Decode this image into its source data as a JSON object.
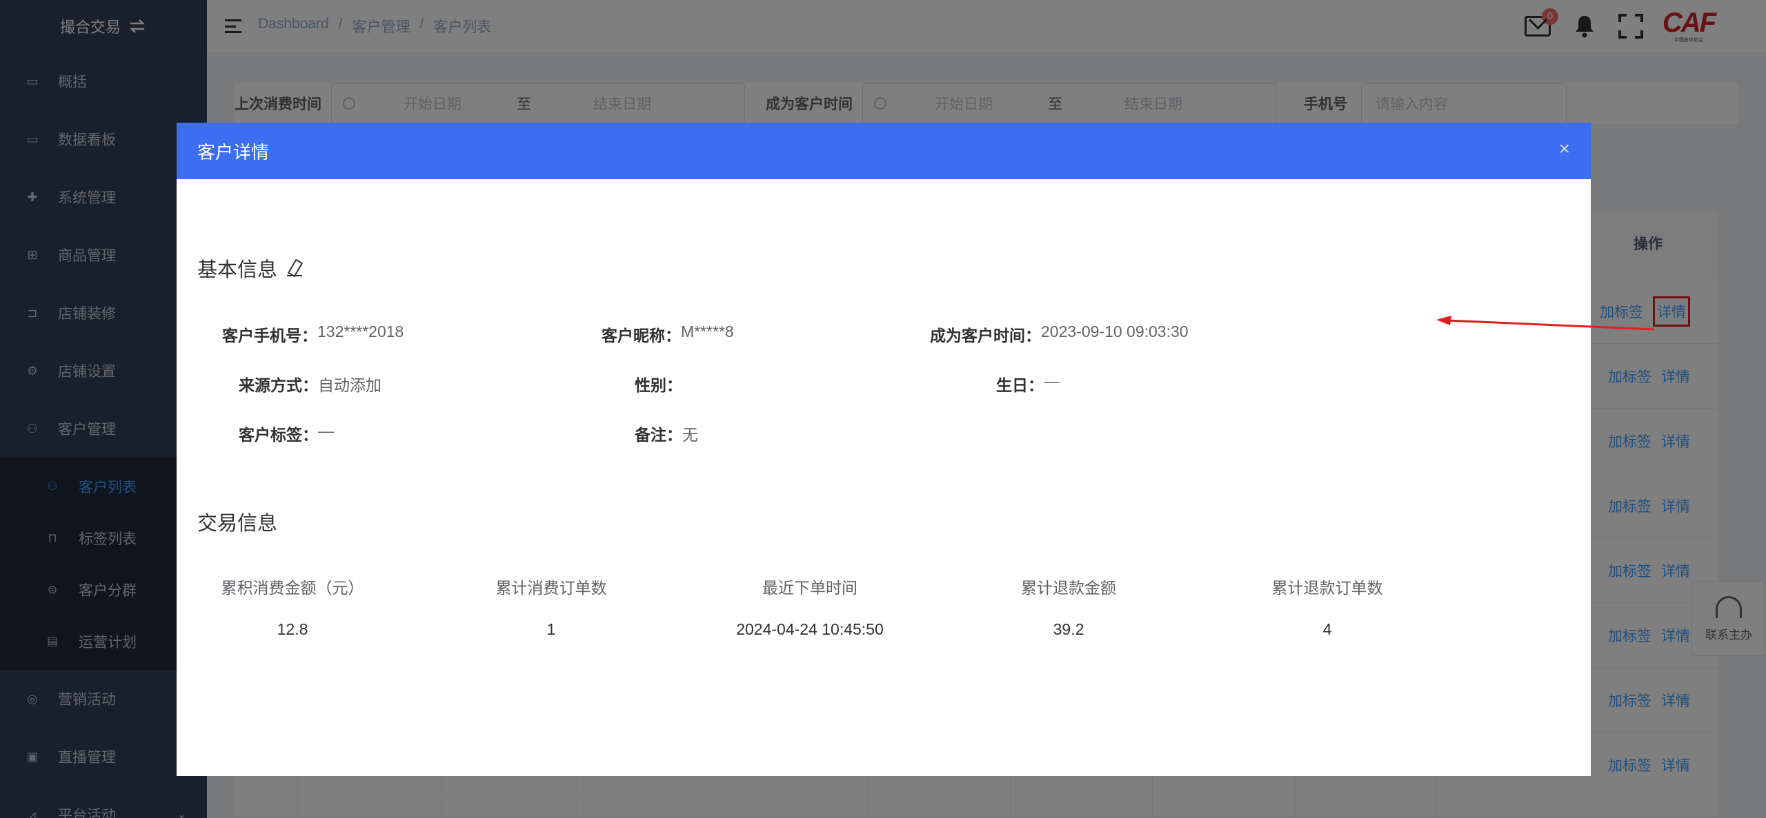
{
  "sidebar": {
    "brand": "撮合交易",
    "items": [
      {
        "label": "概括",
        "icon": "monitor-icon"
      },
      {
        "label": "数据看板",
        "icon": "monitor-icon"
      },
      {
        "label": "系统管理",
        "icon": "gear-icon"
      },
      {
        "label": "商品管理",
        "icon": "box-icon"
      },
      {
        "label": "店铺装修",
        "icon": "cart-icon"
      },
      {
        "label": "店铺设置",
        "icon": "settings-icon"
      },
      {
        "label": "客户管理",
        "icon": "user-icon"
      }
    ],
    "sub_items": [
      {
        "label": "客户列表",
        "icon": "user-icon",
        "active": true
      },
      {
        "label": "标签列表",
        "icon": "bookmark-icon"
      },
      {
        "label": "客户分群",
        "icon": "group-icon"
      },
      {
        "label": "运营计划",
        "icon": "card-icon"
      }
    ],
    "items_after": [
      {
        "label": "营销活动",
        "icon": "compass-icon"
      },
      {
        "label": "直播管理",
        "icon": "video-icon"
      },
      {
        "label": "平台活动",
        "icon": "chart-icon"
      }
    ]
  },
  "navbar": {
    "breadcrumb": [
      "Dashboard",
      "/",
      "客户管理",
      "/",
      "客户列表"
    ],
    "mail_badge": "0",
    "logo_text": "CAF",
    "logo_sub": "中国肢体协会"
  },
  "filter": {
    "last_consume_label": "上次消费时间",
    "become_customer_label": "成为客户时间",
    "start_placeholder": "开始日期",
    "to": "至",
    "end_placeholder": "结束日期",
    "phone_label": "手机号",
    "phone_placeholder": "请输入内容"
  },
  "table": {
    "op_header": "操作",
    "add_tag": "加标签",
    "detail": "详情",
    "row_count": 8
  },
  "contact": {
    "label": "联系主办"
  },
  "dialog": {
    "title": "客户详情",
    "close": "×",
    "basic_title": "基本信息",
    "basic": {
      "phone_k": "客户手机号：",
      "phone_v": "132****2018",
      "nick_k": "客户昵称：",
      "nick_v": "M*****8",
      "become_k": "成为客户时间：",
      "become_v": "2023-09-10 09:03:30",
      "source_k": "来源方式：",
      "source_v": "自动添加",
      "gender_k": "性别：",
      "gender_v": "",
      "birthday_k": "生日：",
      "birthday_v": "—",
      "tag_k": "客户标签：",
      "tag_v": "—",
      "remark_k": "备注：",
      "remark_v": "无"
    },
    "trade_title": "交易信息",
    "trade": [
      {
        "header": "累积消费金额（元）",
        "value": "12.8"
      },
      {
        "header": "累计消费订单数",
        "value": "1"
      },
      {
        "header": "最近下单时间",
        "value": "2024-04-24 10:45:50"
      },
      {
        "header": "累计退款金额",
        "value": "39.2"
      },
      {
        "header": "累计退款订单数",
        "value": "4"
      }
    ]
  }
}
